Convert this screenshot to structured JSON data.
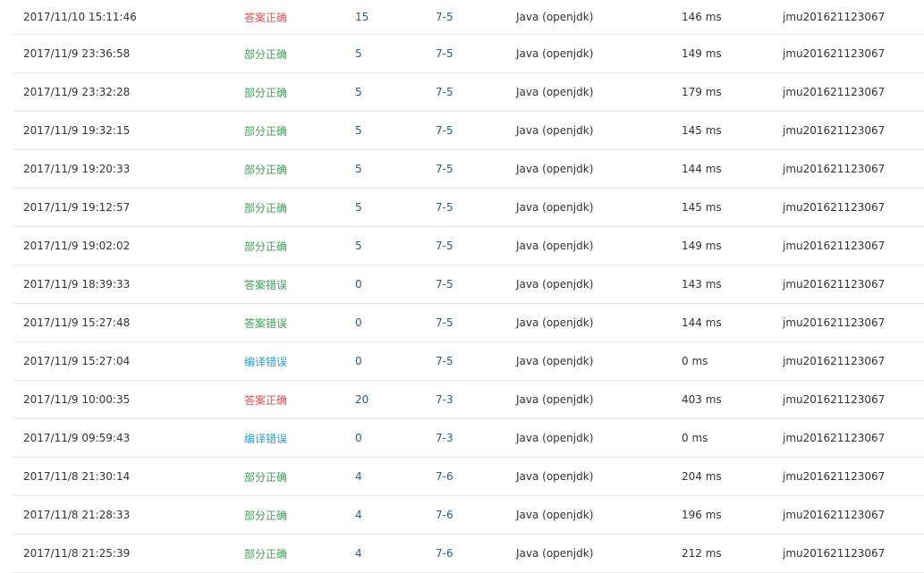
{
  "colors": {
    "accepted": "#d9534f",
    "partial": "#3ea055",
    "wrong": "#3ea055",
    "compile_error": "#2a9fd6",
    "link": "#2a5b8c",
    "text": "#333333"
  },
  "submissions": [
    {
      "time": "2017/11/10 15:11:46",
      "status": "答案正确",
      "status_type": "accepted",
      "score": "15",
      "problem": "7-5",
      "language": "Java (openjdk)",
      "run_time": "146 ms",
      "user": "jmu201621123067"
    },
    {
      "time": "2017/11/9 23:36:58",
      "status": "部分正确",
      "status_type": "partial",
      "score": "5",
      "problem": "7-5",
      "language": "Java (openjdk)",
      "run_time": "149 ms",
      "user": "jmu201621123067"
    },
    {
      "time": "2017/11/9 23:32:28",
      "status": "部分正确",
      "status_type": "partial",
      "score": "5",
      "problem": "7-5",
      "language": "Java (openjdk)",
      "run_time": "179 ms",
      "user": "jmu201621123067"
    },
    {
      "time": "2017/11/9 19:32:15",
      "status": "部分正确",
      "status_type": "partial",
      "score": "5",
      "problem": "7-5",
      "language": "Java (openjdk)",
      "run_time": "145 ms",
      "user": "jmu201621123067"
    },
    {
      "time": "2017/11/9 19:20:33",
      "status": "部分正确",
      "status_type": "partial",
      "score": "5",
      "problem": "7-5",
      "language": "Java (openjdk)",
      "run_time": "144 ms",
      "user": "jmu201621123067"
    },
    {
      "time": "2017/11/9 19:12:57",
      "status": "部分正确",
      "status_type": "partial",
      "score": "5",
      "problem": "7-5",
      "language": "Java (openjdk)",
      "run_time": "145 ms",
      "user": "jmu201621123067"
    },
    {
      "time": "2017/11/9 19:02:02",
      "status": "部分正确",
      "status_type": "partial",
      "score": "5",
      "problem": "7-5",
      "language": "Java (openjdk)",
      "run_time": "149 ms",
      "user": "jmu201621123067"
    },
    {
      "time": "2017/11/9 18:39:33",
      "status": "答案错误",
      "status_type": "wrong",
      "score": "0",
      "problem": "7-5",
      "language": "Java (openjdk)",
      "run_time": "143 ms",
      "user": "jmu201621123067"
    },
    {
      "time": "2017/11/9 15:27:48",
      "status": "答案错误",
      "status_type": "wrong",
      "score": "0",
      "problem": "7-5",
      "language": "Java (openjdk)",
      "run_time": "144 ms",
      "user": "jmu201621123067"
    },
    {
      "time": "2017/11/9 15:27:04",
      "status": "编译错误",
      "status_type": "compile",
      "score": "0",
      "problem": "7-5",
      "language": "Java (openjdk)",
      "run_time": "0 ms",
      "user": "jmu201621123067"
    },
    {
      "time": "2017/11/9 10:00:35",
      "status": "答案正确",
      "status_type": "accepted",
      "score": "20",
      "problem": "7-3",
      "language": "Java (openjdk)",
      "run_time": "403 ms",
      "user": "jmu201621123067"
    },
    {
      "time": "2017/11/9 09:59:43",
      "status": "编译错误",
      "status_type": "compile",
      "score": "0",
      "problem": "7-3",
      "language": "Java (openjdk)",
      "run_time": "0 ms",
      "user": "jmu201621123067"
    },
    {
      "time": "2017/11/8 21:30:14",
      "status": "部分正确",
      "status_type": "partial",
      "score": "4",
      "problem": "7-6",
      "language": "Java (openjdk)",
      "run_time": "204 ms",
      "user": "jmu201621123067"
    },
    {
      "time": "2017/11/8 21:28:33",
      "status": "部分正确",
      "status_type": "partial",
      "score": "4",
      "problem": "7-6",
      "language": "Java (openjdk)",
      "run_time": "196 ms",
      "user": "jmu201621123067"
    },
    {
      "time": "2017/11/8 21:25:39",
      "status": "部分正确",
      "status_type": "partial",
      "score": "4",
      "problem": "7-6",
      "language": "Java (openjdk)",
      "run_time": "212 ms",
      "user": "jmu201621123067"
    }
  ]
}
